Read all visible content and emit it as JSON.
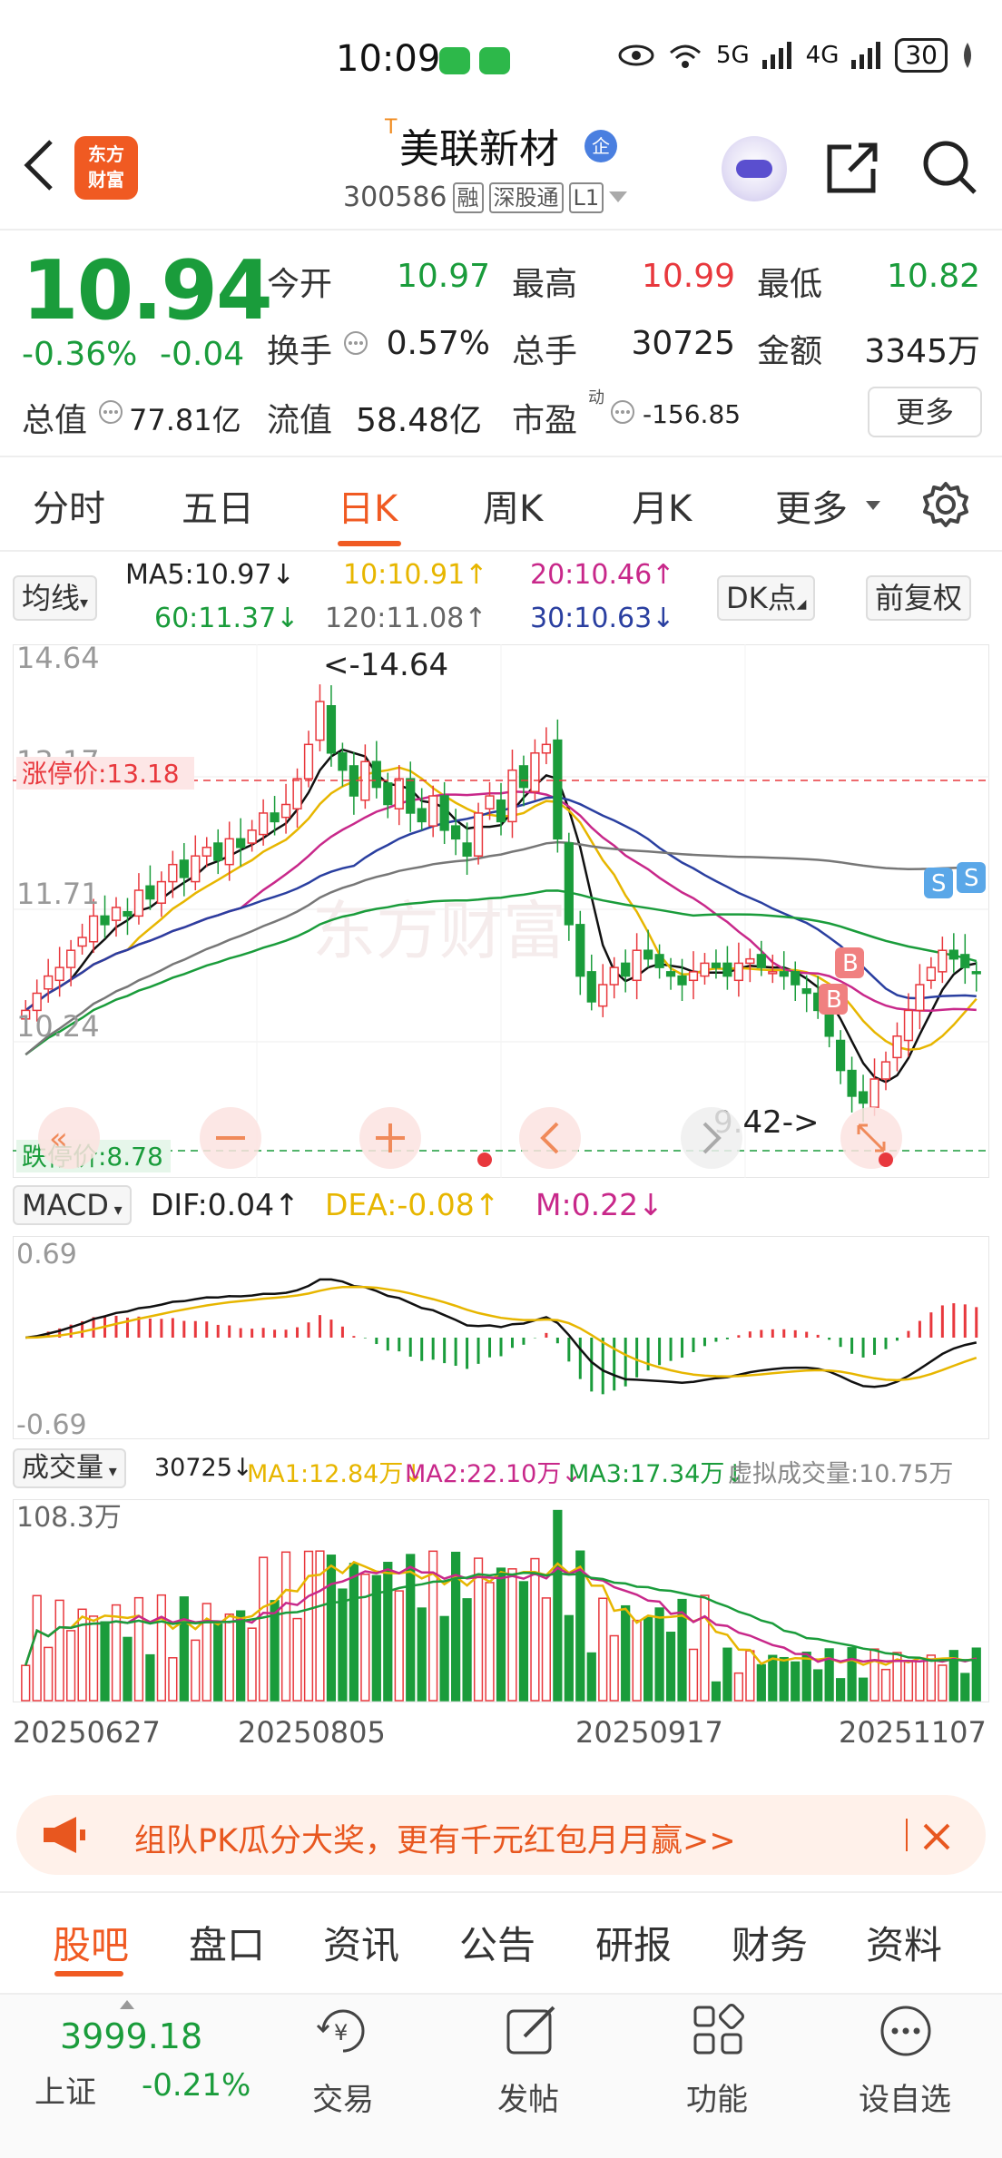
{
  "status": {
    "time": "10:09",
    "battery": "30",
    "net5g": "5G",
    "net4g": "4G"
  },
  "header": {
    "back_icon": "chevron-left",
    "logo_line1": "东方",
    "logo_line2": "财富",
    "tag": "T",
    "title": "美联新材",
    "enterprise_badge": "企",
    "code": "300586",
    "tags": [
      "融",
      "深股通",
      "L1"
    ]
  },
  "quote": {
    "price": "10.94",
    "pct": "-0.36%",
    "chg": "-0.04",
    "open_label": "今开",
    "open": "10.97",
    "high_label": "最高",
    "high": "10.99",
    "low_label": "最低",
    "low": "10.82",
    "turnover_label": "换手",
    "turnover": "0.57%",
    "volume_label": "总手",
    "volume": "30725",
    "amount_label": "金额",
    "amount": "3345万",
    "mcap_label": "总值",
    "mcap": "77.81亿",
    "float_label": "流值",
    "float": "58.48亿",
    "pe_label": "市盈",
    "pe_sup": "动",
    "pe": "-156.85",
    "more": "更多"
  },
  "period_tabs": [
    "分时",
    "五日",
    "日K",
    "周K",
    "月K",
    "更多"
  ],
  "ma_row": {
    "selector": "均线",
    "ma5": "MA5:10.97",
    "ma10": "10:10.91",
    "ma20": "20:10.46",
    "ma60": "60:11.37",
    "ma120": "120:11.08",
    "ma30": "30:10.63",
    "dk": "DK点",
    "fq": "前复权"
  },
  "chart_data": [
    {
      "type": "candlestick",
      "title": "",
      "y_ticks": [
        "14.64",
        "13.17",
        "11.71",
        "10.24"
      ],
      "ylim": [
        8.78,
        14.64
      ],
      "limit_up_label": "涨停价:13.18",
      "limit_up": 13.18,
      "limit_down_label": "跌停价:8.78",
      "limit_down": 8.78,
      "max_annotation": "<-14.64",
      "min_annotation": "9.42->",
      "markers": [
        "B",
        "B",
        "S",
        "S"
      ],
      "closes": [
        10.5,
        10.7,
        10.9,
        11.0,
        11.2,
        11.35,
        11.6,
        11.5,
        11.7,
        11.6,
        11.9,
        11.8,
        12.0,
        12.2,
        12.05,
        12.3,
        12.4,
        12.25,
        12.5,
        12.4,
        12.6,
        12.8,
        12.7,
        12.9,
        13.2,
        13.6,
        14.1,
        13.5,
        13.3,
        13.0,
        13.4,
        13.1,
        12.9,
        13.2,
        12.8,
        12.7,
        13.0,
        12.6,
        12.5,
        12.3,
        12.8,
        13.0,
        12.7,
        13.3,
        13.1,
        13.5,
        13.6,
        12.5,
        11.5,
        10.9,
        10.6,
        10.8,
        11.0,
        10.9,
        11.2,
        11.1,
        11.0,
        10.9,
        10.8,
        10.95,
        11.05,
        11.0,
        10.9,
        11.05,
        11.1,
        11.0,
        10.95,
        10.9,
        10.8,
        10.7,
        10.5,
        10.2,
        9.8,
        9.5,
        9.42,
        9.7,
        9.9,
        10.2,
        10.5,
        10.8,
        11.0,
        11.2,
        11.1,
        11.0,
        10.94
      ],
      "ma_lines": [
        {
          "name": "MA5",
          "value": "10.97",
          "color": "#111111"
        },
        {
          "name": "MA10",
          "value": "10.91",
          "color": "#e7b600"
        },
        {
          "name": "MA20",
          "value": "10.46",
          "color": "#c8288a"
        },
        {
          "name": "MA30",
          "value": "10.63",
          "color": "#2a3fa0"
        },
        {
          "name": "MA60",
          "value": "11.37",
          "color": "#1a9c3b"
        },
        {
          "name": "MA120",
          "value": "11.08",
          "color": "#777777"
        }
      ]
    },
    {
      "type": "bar",
      "title": "MACD",
      "series": [
        {
          "name": "DIF",
          "value": "0.04"
        },
        {
          "name": "DEA",
          "value": "-0.08"
        },
        {
          "name": "M",
          "value": "0.22"
        }
      ],
      "y_ticks": [
        "0.69",
        "-0.69"
      ],
      "ylim": [
        -0.69,
        0.69
      ]
    },
    {
      "type": "bar",
      "title": "成交量",
      "y_ticks": [
        "108.3万"
      ],
      "x_ticks": [
        "20250627",
        "20250805",
        "20250917",
        "20251107"
      ],
      "legend": [
        "30725",
        "MA1:12.84万",
        "MA2:22.10万",
        "MA3:17.34万",
        "虚拟成交量:10.75万"
      ],
      "max": 108.3
    }
  ],
  "macd_row": {
    "selector": "MACD",
    "dif": "DIF:0.04",
    "dea": "DEA:-0.08",
    "m": "M:0.22"
  },
  "vol_row": {
    "selector": "成交量",
    "v": "30725",
    "ma1": "MA1:12.84万",
    "ma2": "MA2:22.10万",
    "ma3": "MA3:17.34万",
    "virt": "虚拟成交量:10.75万",
    "ytop": "108.3万"
  },
  "x_labels": [
    "20250627",
    "20250805",
    "20250917",
    "20251107"
  ],
  "banner": {
    "text": "组队PK瓜分大奖，更有千元红包月月赢>>"
  },
  "bottom_tabs": [
    "股吧",
    "盘口",
    "资讯",
    "公告",
    "研报",
    "财务",
    "资料"
  ],
  "bottom_nav": {
    "index_value": "3999.18",
    "index_name": "上证",
    "index_pct": "-0.21%",
    "items": [
      "交易",
      "发帖",
      "功能",
      "设自选"
    ]
  },
  "colors": {
    "up": "#e8383d",
    "down": "#1a9c3b",
    "accent": "#f05a22"
  }
}
